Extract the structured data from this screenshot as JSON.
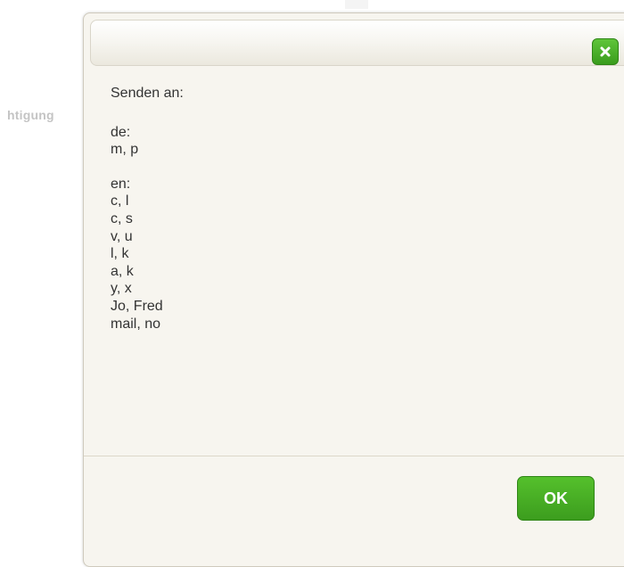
{
  "background": {
    "fragment_text": "htigung"
  },
  "dialog": {
    "close_icon": "close-x-icon",
    "heading": "Senden an:",
    "groups": [
      {
        "label": "de:",
        "items": [
          "m, p"
        ]
      },
      {
        "label": "en:",
        "items": [
          "c, l",
          "c, s",
          "v, u",
          "l, k",
          "a, k",
          "y, x",
          "Jo, Fred",
          "mail, no"
        ]
      }
    ],
    "ok_label": "OK"
  },
  "colors": {
    "accent_green": "#3c9d1e",
    "dialog_bg": "#f7f5ef",
    "text": "#333333"
  }
}
